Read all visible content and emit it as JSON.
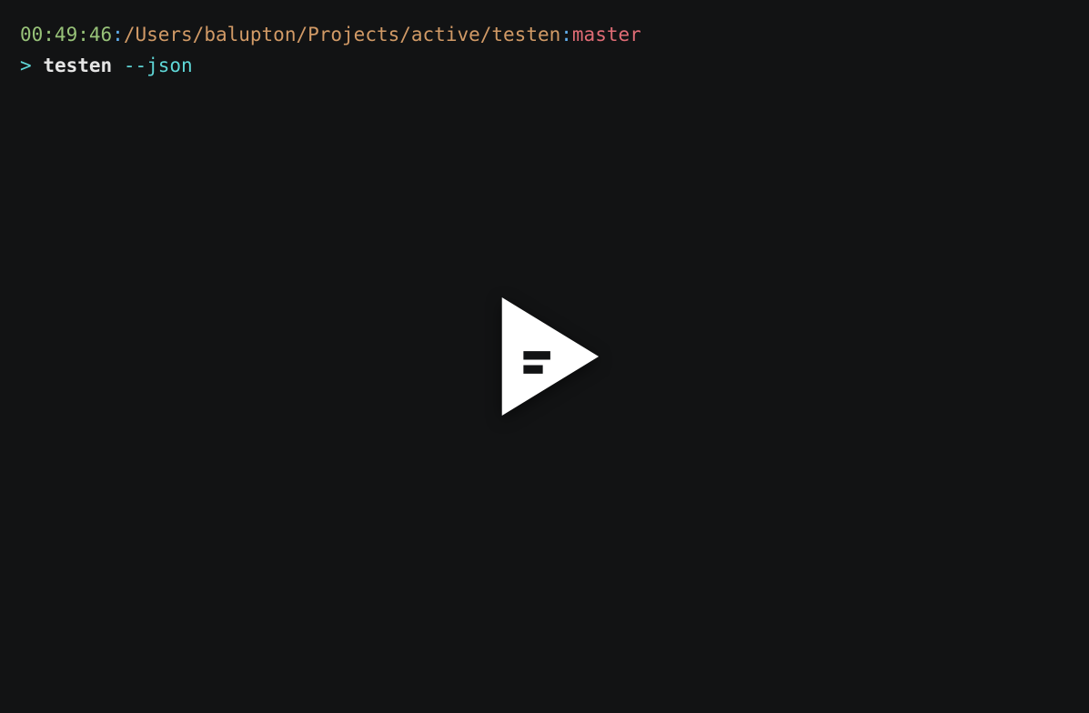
{
  "prompt": {
    "time": "00:49:46",
    "sep1": ":",
    "path": "/Users/balupton/Projects/active/testen",
    "sep2": ":",
    "branch": "master",
    "prompt_char": ">",
    "command": "testen",
    "command_arg": "--json"
  },
  "play_icon": "play-icon"
}
